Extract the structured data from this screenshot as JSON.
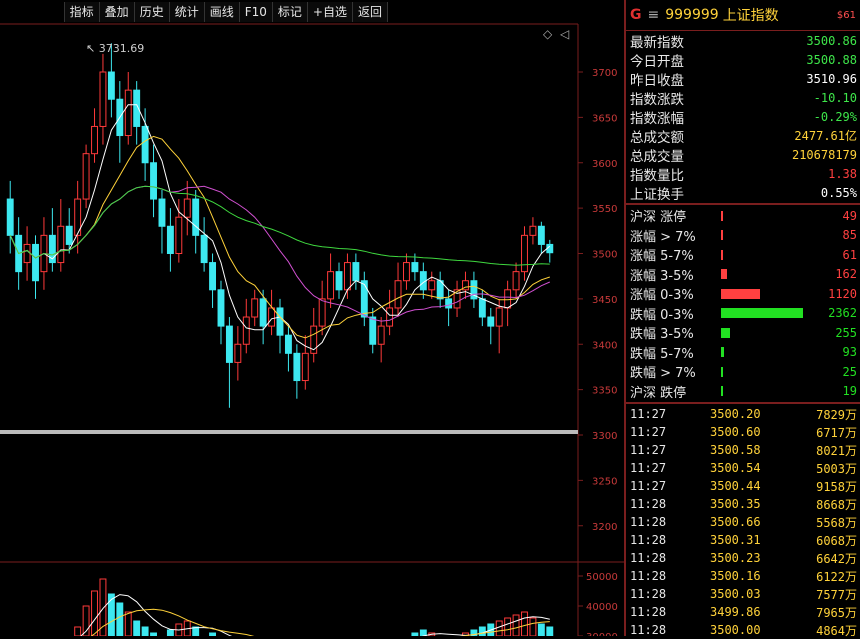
{
  "toolbar": {
    "items": [
      "指标",
      "叠加",
      "历史",
      "统计",
      "画线",
      "F10",
      "标记",
      "+自选",
      "返回"
    ]
  },
  "peak_label": "3731.69",
  "chart": {
    "price_axis": [
      {
        "label": "3700",
        "v": 3700
      },
      {
        "label": "3650",
        "v": 3650
      },
      {
        "label": "3600",
        "v": 3600
      },
      {
        "label": "3550",
        "v": 3550
      },
      {
        "label": "3500",
        "v": 3500
      },
      {
        "label": "3450",
        "v": 3450
      },
      {
        "label": "3400",
        "v": 3400
      },
      {
        "label": "3350",
        "v": 3350
      },
      {
        "label": "3300",
        "v": 3300
      },
      {
        "label": "3250",
        "v": 3250
      },
      {
        "label": "3200",
        "v": 3200
      }
    ],
    "volume_axis": [
      {
        "label": "50000",
        "v": 50000
      },
      {
        "label": "40000",
        "v": 40000
      },
      {
        "label": "30000",
        "v": 30000
      }
    ],
    "candles": [
      [
        3560,
        3520,
        3580,
        3500
      ],
      [
        3520,
        3480,
        3540,
        3460
      ],
      [
        3490,
        3510,
        3530,
        3470
      ],
      [
        3510,
        3470,
        3520,
        3450
      ],
      [
        3480,
        3520,
        3540,
        3460
      ],
      [
        3520,
        3490,
        3550,
        3480
      ],
      [
        3490,
        3530,
        3560,
        3480
      ],
      [
        3530,
        3510,
        3550,
        3500
      ],
      [
        3520,
        3560,
        3580,
        3500
      ],
      [
        3560,
        3610,
        3620,
        3550
      ],
      [
        3610,
        3640,
        3660,
        3600
      ],
      [
        3640,
        3700,
        3720,
        3620
      ],
      [
        3700,
        3670,
        3731.69,
        3650
      ],
      [
        3670,
        3630,
        3690,
        3600
      ],
      [
        3630,
        3680,
        3700,
        3620
      ],
      [
        3680,
        3640,
        3690,
        3620
      ],
      [
        3640,
        3600,
        3660,
        3580
      ],
      [
        3600,
        3560,
        3620,
        3540
      ],
      [
        3560,
        3530,
        3570,
        3500
      ],
      [
        3530,
        3500,
        3550,
        3480
      ],
      [
        3500,
        3540,
        3560,
        3490
      ],
      [
        3540,
        3560,
        3580,
        3520
      ],
      [
        3560,
        3520,
        3570,
        3500
      ],
      [
        3520,
        3490,
        3540,
        3480
      ],
      [
        3490,
        3460,
        3500,
        3440
      ],
      [
        3460,
        3420,
        3470,
        3400
      ],
      [
        3420,
        3380,
        3430,
        3330
      ],
      [
        3380,
        3400,
        3420,
        3360
      ],
      [
        3400,
        3430,
        3450,
        3390
      ],
      [
        3430,
        3450,
        3460,
        3420
      ],
      [
        3450,
        3420,
        3460,
        3400
      ],
      [
        3420,
        3440,
        3460,
        3410
      ],
      [
        3440,
        3410,
        3450,
        3390
      ],
      [
        3410,
        3390,
        3420,
        3370
      ],
      [
        3390,
        3360,
        3400,
        3340
      ],
      [
        3360,
        3390,
        3410,
        3350
      ],
      [
        3390,
        3420,
        3440,
        3380
      ],
      [
        3420,
        3450,
        3470,
        3410
      ],
      [
        3450,
        3480,
        3500,
        3440
      ],
      [
        3480,
        3460,
        3490,
        3450
      ],
      [
        3460,
        3490,
        3500,
        3450
      ],
      [
        3490,
        3470,
        3500,
        3460
      ],
      [
        3470,
        3430,
        3480,
        3420
      ],
      [
        3430,
        3400,
        3440,
        3390
      ],
      [
        3400,
        3420,
        3430,
        3380
      ],
      [
        3420,
        3440,
        3460,
        3410
      ],
      [
        3440,
        3470,
        3490,
        3430
      ],
      [
        3470,
        3490,
        3500,
        3460
      ],
      [
        3490,
        3480,
        3500,
        3470
      ],
      [
        3480,
        3460,
        3490,
        3450
      ],
      [
        3460,
        3470,
        3480,
        3450
      ],
      [
        3470,
        3450,
        3480,
        3440
      ],
      [
        3450,
        3440,
        3460,
        3420
      ],
      [
        3440,
        3460,
        3470,
        3430
      ],
      [
        3460,
        3470,
        3480,
        3450
      ],
      [
        3470,
        3450,
        3480,
        3440
      ],
      [
        3450,
        3430,
        3460,
        3420
      ],
      [
        3430,
        3420,
        3440,
        3400
      ],
      [
        3420,
        3440,
        3450,
        3390
      ],
      [
        3440,
        3460,
        3470,
        3420
      ],
      [
        3460,
        3480,
        3490,
        3450
      ],
      [
        3480,
        3520,
        3530,
        3470
      ],
      [
        3520,
        3530,
        3540,
        3510
      ],
      [
        3530,
        3510,
        3535,
        3500
      ],
      [
        3510,
        3500.86,
        3515,
        3490
      ]
    ],
    "volumes": [
      26000,
      24000,
      28000,
      25000,
      27000,
      26000,
      30000,
      29000,
      33000,
      40000,
      45000,
      49000,
      44000,
      41000,
      38000,
      35000,
      33000,
      31000,
      30000,
      32000,
      34000,
      35000,
      33000,
      30000,
      31000,
      29000,
      28000,
      27000,
      26000,
      25000,
      27000,
      26000,
      25000,
      24000,
      25000,
      26000,
      27000,
      28000,
      29000,
      28000,
      27000,
      26000,
      25000,
      26000,
      27000,
      28000,
      29000,
      30000,
      31000,
      32000,
      31000,
      30000,
      29000,
      30000,
      31000,
      32000,
      33000,
      34000,
      35000,
      36000,
      37000,
      38000,
      36000,
      34000,
      33000
    ]
  },
  "panel": {
    "g": "G",
    "menu_icon": "menu-icon",
    "code": "999999",
    "name": "上证指数",
    "tag": "$61",
    "stats": [
      {
        "label": "最新指数",
        "value": "3500.86",
        "color": "#3ee64a"
      },
      {
        "label": "今日开盘",
        "value": "3500.88",
        "color": "#3ee64a"
      },
      {
        "label": "昨日收盘",
        "value": "3510.96",
        "color": "#ffffff"
      },
      {
        "label": "指数涨跌",
        "value": "-10.10",
        "color": "#3ee64a"
      },
      {
        "label": "指数涨幅",
        "value": "-0.29%",
        "color": "#3ee64a"
      },
      {
        "label": "总成交额",
        "value": "2477.61亿",
        "color": "#ffd23a"
      },
      {
        "label": "总成交量",
        "value": "210678179",
        "color": "#ffd23a"
      },
      {
        "label": "指数量比",
        "value": "1.38",
        "color": "#ff4040"
      },
      {
        "label": "上证换手",
        "value": "0.55%",
        "color": "#ffffff"
      }
    ],
    "breadth": [
      {
        "label": "沪深 涨停",
        "value": "49",
        "color": "#ff4040",
        "frac": 0.013
      },
      {
        "label": "涨幅 > 7%",
        "value": "85",
        "color": "#ff4040",
        "frac": 0.02
      },
      {
        "label": "涨幅 5-7%",
        "value": "61",
        "color": "#ff4040",
        "frac": 0.015
      },
      {
        "label": "涨幅 3-5%",
        "value": "162",
        "color": "#ff4040",
        "frac": 0.07
      },
      {
        "label": "涨幅 0-3%",
        "value": "1120",
        "color": "#ff4040",
        "frac": 0.48
      },
      {
        "label": "跌幅 0-3%",
        "value": "2362",
        "color": "#22e022",
        "frac": 1.0
      },
      {
        "label": "跌幅 3-5%",
        "value": "255",
        "color": "#22e022",
        "frac": 0.11
      },
      {
        "label": "跌幅 5-7%",
        "value": "93",
        "color": "#22e022",
        "frac": 0.04
      },
      {
        "label": "跌幅 > 7%",
        "value": "25",
        "color": "#22e022",
        "frac": 0.01
      },
      {
        "label": "沪深 跌停",
        "value": "19",
        "color": "#22e022",
        "frac": 0.008
      }
    ],
    "ticks": [
      {
        "time": "11:27",
        "price": "3500.20",
        "vol": "7829万"
      },
      {
        "time": "11:27",
        "price": "3500.60",
        "vol": "6717万"
      },
      {
        "time": "11:27",
        "price": "3500.58",
        "vol": "8021万"
      },
      {
        "time": "11:27",
        "price": "3500.54",
        "vol": "5003万"
      },
      {
        "time": "11:27",
        "price": "3500.44",
        "vol": "9158万"
      },
      {
        "time": "11:28",
        "price": "3500.35",
        "vol": "8668万"
      },
      {
        "time": "11:28",
        "price": "3500.66",
        "vol": "5568万"
      },
      {
        "time": "11:28",
        "price": "3500.31",
        "vol": "6068万"
      },
      {
        "time": "11:28",
        "price": "3500.23",
        "vol": "6642万"
      },
      {
        "time": "11:28",
        "price": "3500.16",
        "vol": "6122万"
      },
      {
        "time": "11:28",
        "price": "3500.03",
        "vol": "7577万"
      },
      {
        "time": "11:28",
        "price": "3499.86",
        "vol": "7965万"
      },
      {
        "time": "11:28",
        "price": "3500.00",
        "vol": "4864万"
      }
    ]
  }
}
